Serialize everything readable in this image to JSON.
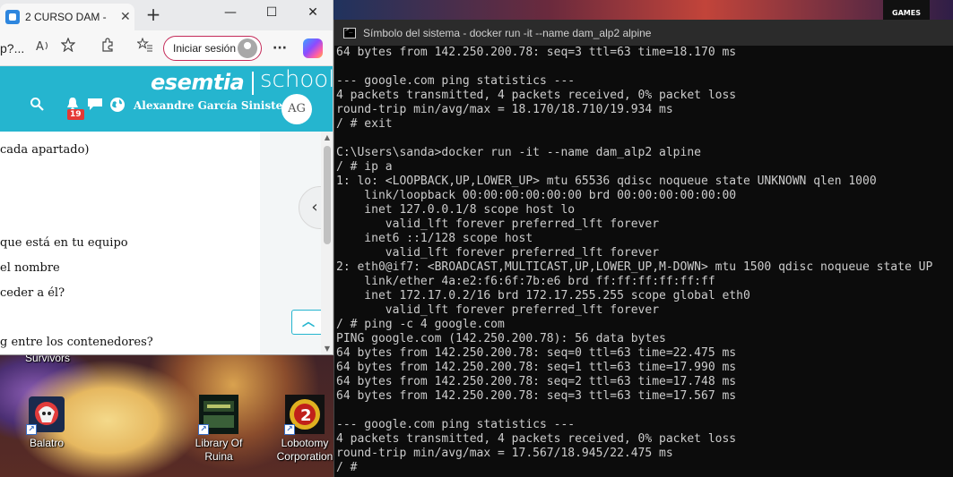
{
  "browser": {
    "tab_title": "2 CURSO DAM -",
    "tab_close": "✕",
    "new_tab": "+",
    "minimize": "—",
    "maximize": "☐",
    "close": "✕",
    "address_fragment": "p?...",
    "signin_label": "Iniciar sesión",
    "more": "···"
  },
  "esemtia": {
    "brand": "esemtia",
    "school": "school",
    "notification_count": "19",
    "user_name": "Alexandre García Sinisterra",
    "user_initials": "AG",
    "collapse_glyph": "‹",
    "up_glyph": "︿",
    "lines": [
      "cada apartado)",
      "que está en tu equipo",
      "el nombre",
      "ceder a él?",
      "g entre los contenedores?"
    ]
  },
  "desktop": {
    "survivors_label": "Survivors",
    "icons": [
      {
        "label": "Balatro"
      },
      {
        "label": "Library Of Ruina"
      },
      {
        "label": "Lobotomy Corporation"
      }
    ],
    "game_badge": "GAMES"
  },
  "terminal": {
    "title": "Símbolo del sistema - docker  run -it --name dam_alp2 alpine",
    "lines": [
      "64 bytes from 142.250.200.78: seq=3 ttl=63 time=18.170 ms",
      "",
      "--- google.com ping statistics ---",
      "4 packets transmitted, 4 packets received, 0% packet loss",
      "round-trip min/avg/max = 18.170/18.710/19.934 ms",
      "/ # exit",
      "",
      "C:\\Users\\sanda>docker run -it --name dam_alp2 alpine",
      "/ # ip a",
      "1: lo: <LOOPBACK,UP,LOWER_UP> mtu 65536 qdisc noqueue state UNKNOWN qlen 1000",
      "    link/loopback 00:00:00:00:00:00 brd 00:00:00:00:00:00",
      "    inet 127.0.0.1/8 scope host lo",
      "       valid_lft forever preferred_lft forever",
      "    inet6 ::1/128 scope host",
      "       valid_lft forever preferred_lft forever",
      "2: eth0@if7: <BROADCAST,MULTICAST,UP,LOWER_UP,M-DOWN> mtu 1500 qdisc noqueue state UP",
      "    link/ether 4a:e2:f6:6f:7b:e6 brd ff:ff:ff:ff:ff:ff",
      "    inet 172.17.0.2/16 brd 172.17.255.255 scope global eth0",
      "       valid_lft forever preferred_lft forever",
      "/ # ping -c 4 google.com",
      "PING google.com (142.250.200.78): 56 data bytes",
      "64 bytes from 142.250.200.78: seq=0 ttl=63 time=22.475 ms",
      "64 bytes from 142.250.200.78: seq=1 ttl=63 time=17.990 ms",
      "64 bytes from 142.250.200.78: seq=2 ttl=63 time=17.748 ms",
      "64 bytes from 142.250.200.78: seq=3 ttl=63 time=17.567 ms",
      "",
      "--- google.com ping statistics ---",
      "4 packets transmitted, 4 packets received, 0% packet loss",
      "round-trip min/avg/max = 17.567/18.945/22.475 ms",
      "/ # "
    ]
  },
  "colors": {
    "esemtia_accent": "#25b5cf",
    "terminal_bg": "#0c0c0c",
    "terminal_fg": "#cccccc",
    "signin_border": "#c42b59"
  }
}
